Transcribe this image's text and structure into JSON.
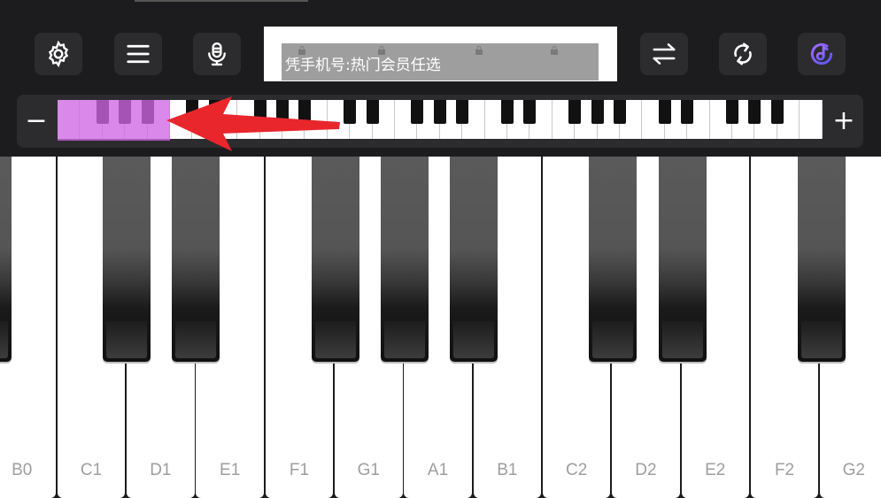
{
  "toolbar": {
    "buttons": [
      {
        "name": "settings",
        "icon": "gear-icon"
      },
      {
        "name": "menu",
        "icon": "hamburger-icon"
      },
      {
        "name": "record",
        "icon": "microphone-icon"
      },
      {
        "name": "swap",
        "icon": "swap-arrows-icon"
      },
      {
        "name": "sync",
        "icon": "refresh-icon"
      },
      {
        "name": "song",
        "icon": "music-note-icon"
      }
    ],
    "accent_color": "#6b63ff"
  },
  "ad_banner": {
    "text": "凭手机号:热门会员任选"
  },
  "mini_keyboard": {
    "minus_label": "−",
    "plus_label": "+",
    "highlight_color": "#d166e6"
  },
  "keys": {
    "white_labels": [
      "B0",
      "C1",
      "D1",
      "E1",
      "F1",
      "G1",
      "A1",
      "B1",
      "C2",
      "D2",
      "E2",
      "F2",
      "G2"
    ]
  }
}
